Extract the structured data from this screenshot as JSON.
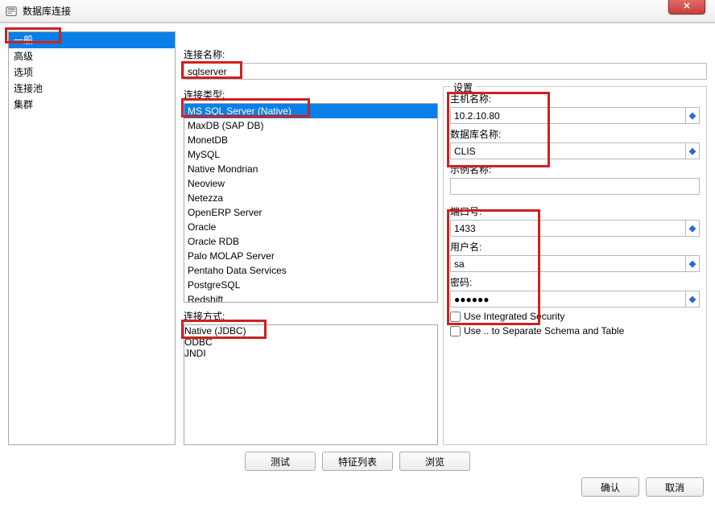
{
  "window": {
    "title": "数据库连接",
    "close_label": "✕"
  },
  "sidebar": {
    "items": [
      {
        "label": "一般",
        "selected": true
      },
      {
        "label": "高级"
      },
      {
        "label": "选项"
      },
      {
        "label": "连接池"
      },
      {
        "label": "集群"
      }
    ]
  },
  "conn_name": {
    "label": "连接名称:",
    "value": "sqlserver"
  },
  "conn_type": {
    "label": "连接类型:",
    "options": [
      {
        "label": "MS SQL Server (Native)",
        "selected": true
      },
      {
        "label": "MaxDB (SAP DB)"
      },
      {
        "label": "MonetDB"
      },
      {
        "label": "MySQL"
      },
      {
        "label": "Native Mondrian"
      },
      {
        "label": "Neoview"
      },
      {
        "label": "Netezza"
      },
      {
        "label": "OpenERP Server"
      },
      {
        "label": "Oracle"
      },
      {
        "label": "Oracle RDB"
      },
      {
        "label": "Palo MOLAP Server"
      },
      {
        "label": "Pentaho Data Services"
      },
      {
        "label": "PostgreSQL"
      },
      {
        "label": "Redshift"
      }
    ]
  },
  "conn_mode": {
    "label": "连接方式:",
    "options": [
      {
        "label": "Native (JDBC)",
        "selected": true
      },
      {
        "label": "ODBC"
      },
      {
        "label": "JNDI"
      }
    ]
  },
  "settings": {
    "legend": "设置",
    "host": {
      "label": "主机名称:",
      "value": "10.2.10.80"
    },
    "db": {
      "label": "数据库名称:",
      "value": "CLIS"
    },
    "instance": {
      "label": "示例名称:",
      "value": ""
    },
    "port": {
      "label": "端口号:",
      "value": "1433"
    },
    "user": {
      "label": "用户名:",
      "value": "sa"
    },
    "pass": {
      "label": "密码:",
      "value": "●●●●●●"
    },
    "integrated": {
      "label": "Use Integrated Security"
    },
    "separate": {
      "label": "Use .. to Separate Schema and Table"
    },
    "var_symbol": "◆"
  },
  "buttons": {
    "test": "测试",
    "feature_list": "特征列表",
    "browse": "浏览",
    "ok": "确认",
    "cancel": "取消"
  }
}
